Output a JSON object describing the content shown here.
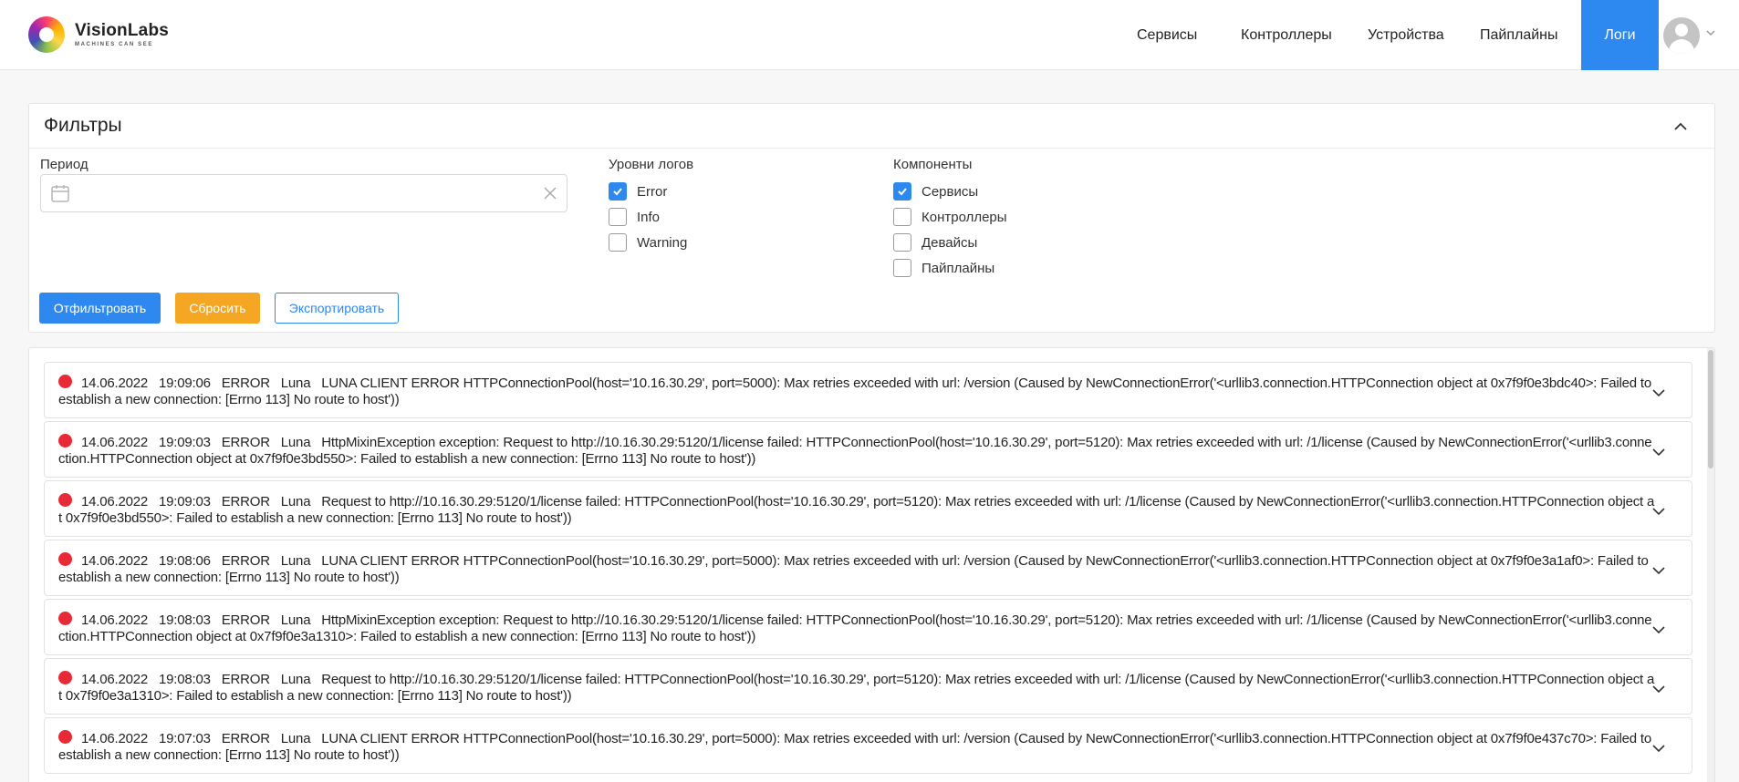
{
  "brand": {
    "name": "VisionLabs",
    "tagline": "MACHINES CAN SEE"
  },
  "nav": {
    "items": [
      {
        "label": "Сервисы"
      },
      {
        "label": "Контроллеры"
      },
      {
        "label": "Устройства"
      },
      {
        "label": "Пайплайны"
      },
      {
        "label": "Логи",
        "active": true
      }
    ]
  },
  "filters": {
    "title": "Фильтры",
    "period_label": "Период",
    "period_value": "",
    "levels_label": "Уровни логов",
    "levels": [
      {
        "label": "Error",
        "checked": true
      },
      {
        "label": "Info",
        "checked": false
      },
      {
        "label": "Warning",
        "checked": false
      }
    ],
    "components_label": "Компоненты",
    "components": [
      {
        "label": "Сервисы",
        "checked": true
      },
      {
        "label": "Контроллеры",
        "checked": false
      },
      {
        "label": "Девайсы",
        "checked": false
      },
      {
        "label": "Пайплайны",
        "checked": false
      }
    ],
    "buttons": {
      "filter": "Отфильтровать",
      "reset": "Сбросить",
      "export": "Экспортировать"
    }
  },
  "logs": [
    {
      "date": "14.06.2022",
      "time": "19:09:06",
      "level": "ERROR",
      "source": "Luna",
      "message": "LUNA CLIENT ERROR HTTPConnectionPool(host='10.16.30.29', port=5000): Max retries exceeded with url: /version (Caused by NewConnectionError('<urllib3.connection.HTTPConnection object at 0x7f9f0e3bdc40>: Failed to establish a new connection: [Errno 113] No route to host'))"
    },
    {
      "date": "14.06.2022",
      "time": "19:09:03",
      "level": "ERROR",
      "source": "Luna",
      "message": "HttpMixinException exception: Request to http://10.16.30.29:5120/1/license failed: HTTPConnectionPool(host='10.16.30.29', port=5120): Max retries exceeded with url: /1/license (Caused by NewConnectionError('<urllib3.connection.HTTPConnection object at 0x7f9f0e3bd550>: Failed to establish a new connection: [Errno 113] No route to host'))"
    },
    {
      "date": "14.06.2022",
      "time": "19:09:03",
      "level": "ERROR",
      "source": "Luna",
      "message": "Request to http://10.16.30.29:5120/1/license failed: HTTPConnectionPool(host='10.16.30.29', port=5120): Max retries exceeded with url: /1/license (Caused by NewConnectionError('<urllib3.connection.HTTPConnection object at 0x7f9f0e3bd550>: Failed to establish a new connection: [Errno 113] No route to host'))"
    },
    {
      "date": "14.06.2022",
      "time": "19:08:06",
      "level": "ERROR",
      "source": "Luna",
      "message": "LUNA CLIENT ERROR HTTPConnectionPool(host='10.16.30.29', port=5000): Max retries exceeded with url: /version (Caused by NewConnectionError('<urllib3.connection.HTTPConnection object at 0x7f9f0e3a1af0>: Failed to establish a new connection: [Errno 113] No route to host'))"
    },
    {
      "date": "14.06.2022",
      "time": "19:08:03",
      "level": "ERROR",
      "source": "Luna",
      "message": "HttpMixinException exception: Request to http://10.16.30.29:5120/1/license failed: HTTPConnectionPool(host='10.16.30.29', port=5120): Max retries exceeded with url: /1/license (Caused by NewConnectionError('<urllib3.connection.HTTPConnection object at 0x7f9f0e3a1310>: Failed to establish a new connection: [Errno 113] No route to host'))"
    },
    {
      "date": "14.06.2022",
      "time": "19:08:03",
      "level": "ERROR",
      "source": "Luna",
      "message": "Request to http://10.16.30.29:5120/1/license failed: HTTPConnectionPool(host='10.16.30.29', port=5120): Max retries exceeded with url: /1/license (Caused by NewConnectionError('<urllib3.connection.HTTPConnection object at 0x7f9f0e3a1310>: Failed to establish a new connection: [Errno 113] No route to host'))"
    },
    {
      "date": "14.06.2022",
      "time": "19:07:03",
      "level": "ERROR",
      "source": "Luna",
      "message": "LUNA CLIENT ERROR HTTPConnectionPool(host='10.16.30.29', port=5000): Max retries exceeded with url: /version (Caused by NewConnectionError('<urllib3.connection.HTTPConnection object at 0x7f9f0e437c70>: Failed to establish a new connection: [Errno 113] No route to host'))"
    }
  ],
  "colors": {
    "accent": "#2d88f0",
    "warning": "#f5a623",
    "error_dot": "#e82a36"
  },
  "icons": {
    "calendar": "calendar-icon",
    "clear": "close-icon",
    "collapse": "chevron-up-icon",
    "expand": "chevron-down-icon",
    "user": "user-avatar-icon",
    "status": "error-dot-icon"
  }
}
